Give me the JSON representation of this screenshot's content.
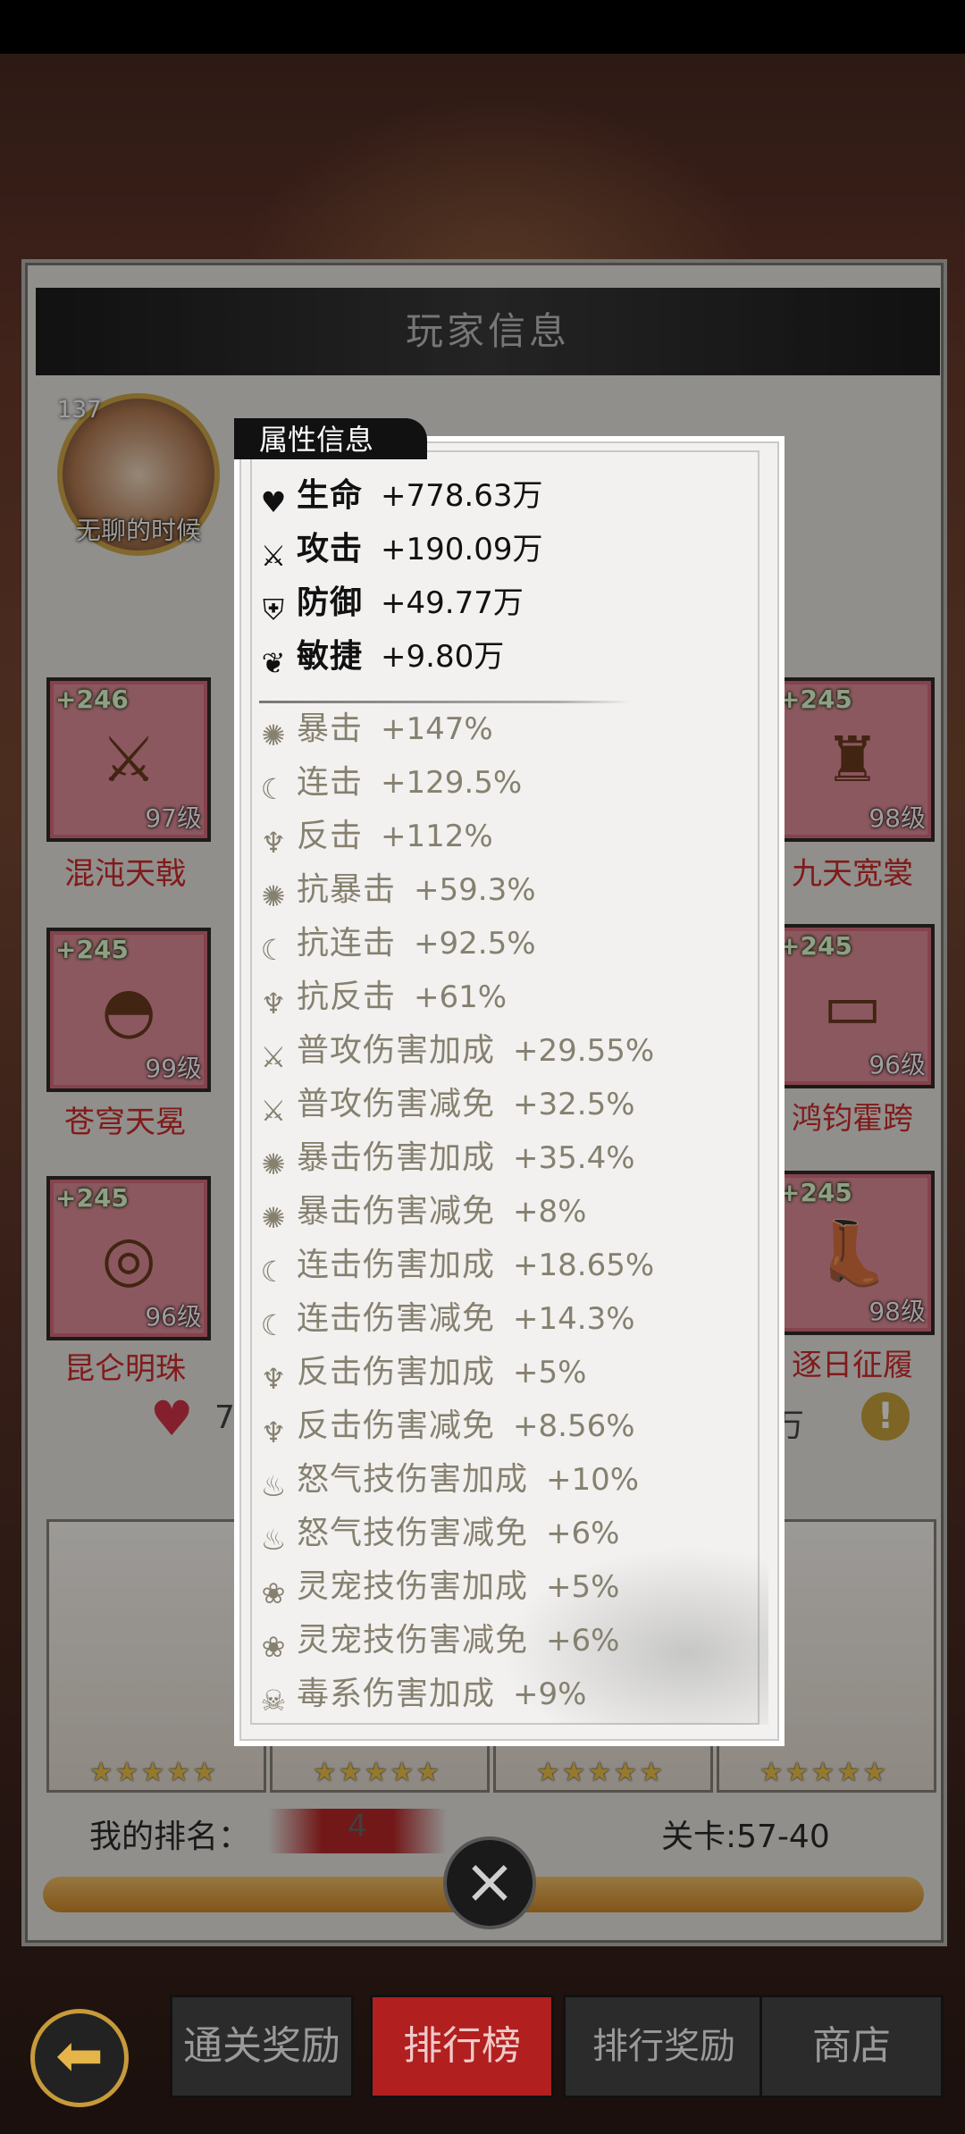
{
  "panel": {
    "title": "玩家信息"
  },
  "player": {
    "level": "137",
    "name": "无聊的时候"
  },
  "equipment": [
    {
      "plus": "+246",
      "level": "97级",
      "name": "混沌天戟",
      "icon": "halberd-icon"
    },
    {
      "plus": "+245",
      "level": "98级",
      "name": "九天宽裳",
      "icon": "armor-icon"
    },
    {
      "plus": "+245",
      "level": "99级",
      "name": "苍穹天冕",
      "icon": "hat-icon"
    },
    {
      "plus": "+245",
      "level": "96级",
      "name": "鸿钧霍跨",
      "icon": "belt-icon"
    },
    {
      "plus": "+245",
      "level": "96级",
      "name": "昆仑明珠",
      "icon": "necklace-icon"
    },
    {
      "plus": "+245",
      "level": "98级",
      "name": "逐日征履",
      "icon": "boots-icon"
    }
  ],
  "stats_partial": {
    "left": "7",
    "right": "万"
  },
  "pets": [
    {
      "stars": "★★★★★"
    },
    {
      "stars": "★★★★★"
    },
    {
      "stars": "★★★★★"
    },
    {
      "stars": "★★★★★"
    }
  ],
  "rank": {
    "label": "我的排名：",
    "value": "4",
    "stage": "关卡:57-40"
  },
  "tabs": [
    "通关奖励",
    "排行榜",
    "排行奖励",
    "商店"
  ],
  "attributes": {
    "title": "属性信息",
    "main": [
      {
        "icon": "heart-icon",
        "name": "生命",
        "value": "+778.63万"
      },
      {
        "icon": "swords-icon",
        "name": "攻击",
        "value": "+190.09万"
      },
      {
        "icon": "shield-icon",
        "name": "防御",
        "value": "+49.77万"
      },
      {
        "icon": "wing-icon",
        "name": "敏捷",
        "value": "+9.80万"
      }
    ],
    "sub": [
      {
        "icon": "crit-icon",
        "name": "暴击",
        "value": "+147%"
      },
      {
        "icon": "combo-icon",
        "name": "连击",
        "value": "+129.5%"
      },
      {
        "icon": "counter-icon",
        "name": "反击",
        "value": "+112%"
      },
      {
        "icon": "crit-icon",
        "name": "抗暴击",
        "value": "+59.3%"
      },
      {
        "icon": "combo-icon",
        "name": "抗连击",
        "value": "+92.5%"
      },
      {
        "icon": "counter-icon",
        "name": "抗反击",
        "value": "+61%"
      },
      {
        "icon": "swords-icon",
        "name": "普攻伤害加成",
        "value": "+29.55%"
      },
      {
        "icon": "swords-icon",
        "name": "普攻伤害减免",
        "value": "+32.5%"
      },
      {
        "icon": "crit-icon",
        "name": "暴击伤害加成",
        "value": "+35.4%"
      },
      {
        "icon": "crit-icon",
        "name": "暴击伤害减免",
        "value": "+8%"
      },
      {
        "icon": "combo-icon",
        "name": "连击伤害加成",
        "value": "+18.65%"
      },
      {
        "icon": "combo-icon",
        "name": "连击伤害减免",
        "value": "+14.3%"
      },
      {
        "icon": "counter-icon",
        "name": "反击伤害加成",
        "value": "+5%"
      },
      {
        "icon": "counter-icon",
        "name": "反击伤害减免",
        "value": "+8.56%"
      },
      {
        "icon": "rage-icon",
        "name": "怒气技伤害加成",
        "value": "+10%"
      },
      {
        "icon": "rage-icon",
        "name": "怒气技伤害减免",
        "value": "+6%"
      },
      {
        "icon": "paw-icon",
        "name": "灵宠技伤害加成",
        "value": "+5%"
      },
      {
        "icon": "paw-icon",
        "name": "灵宠技伤害减免",
        "value": "+6%"
      },
      {
        "icon": "skull-icon",
        "name": "毒系伤害加成",
        "value": "+9%"
      }
    ]
  },
  "colors": {
    "accent_red": "#b11f1f",
    "gold": "#d2a84a",
    "sub_text": "#86806f"
  }
}
